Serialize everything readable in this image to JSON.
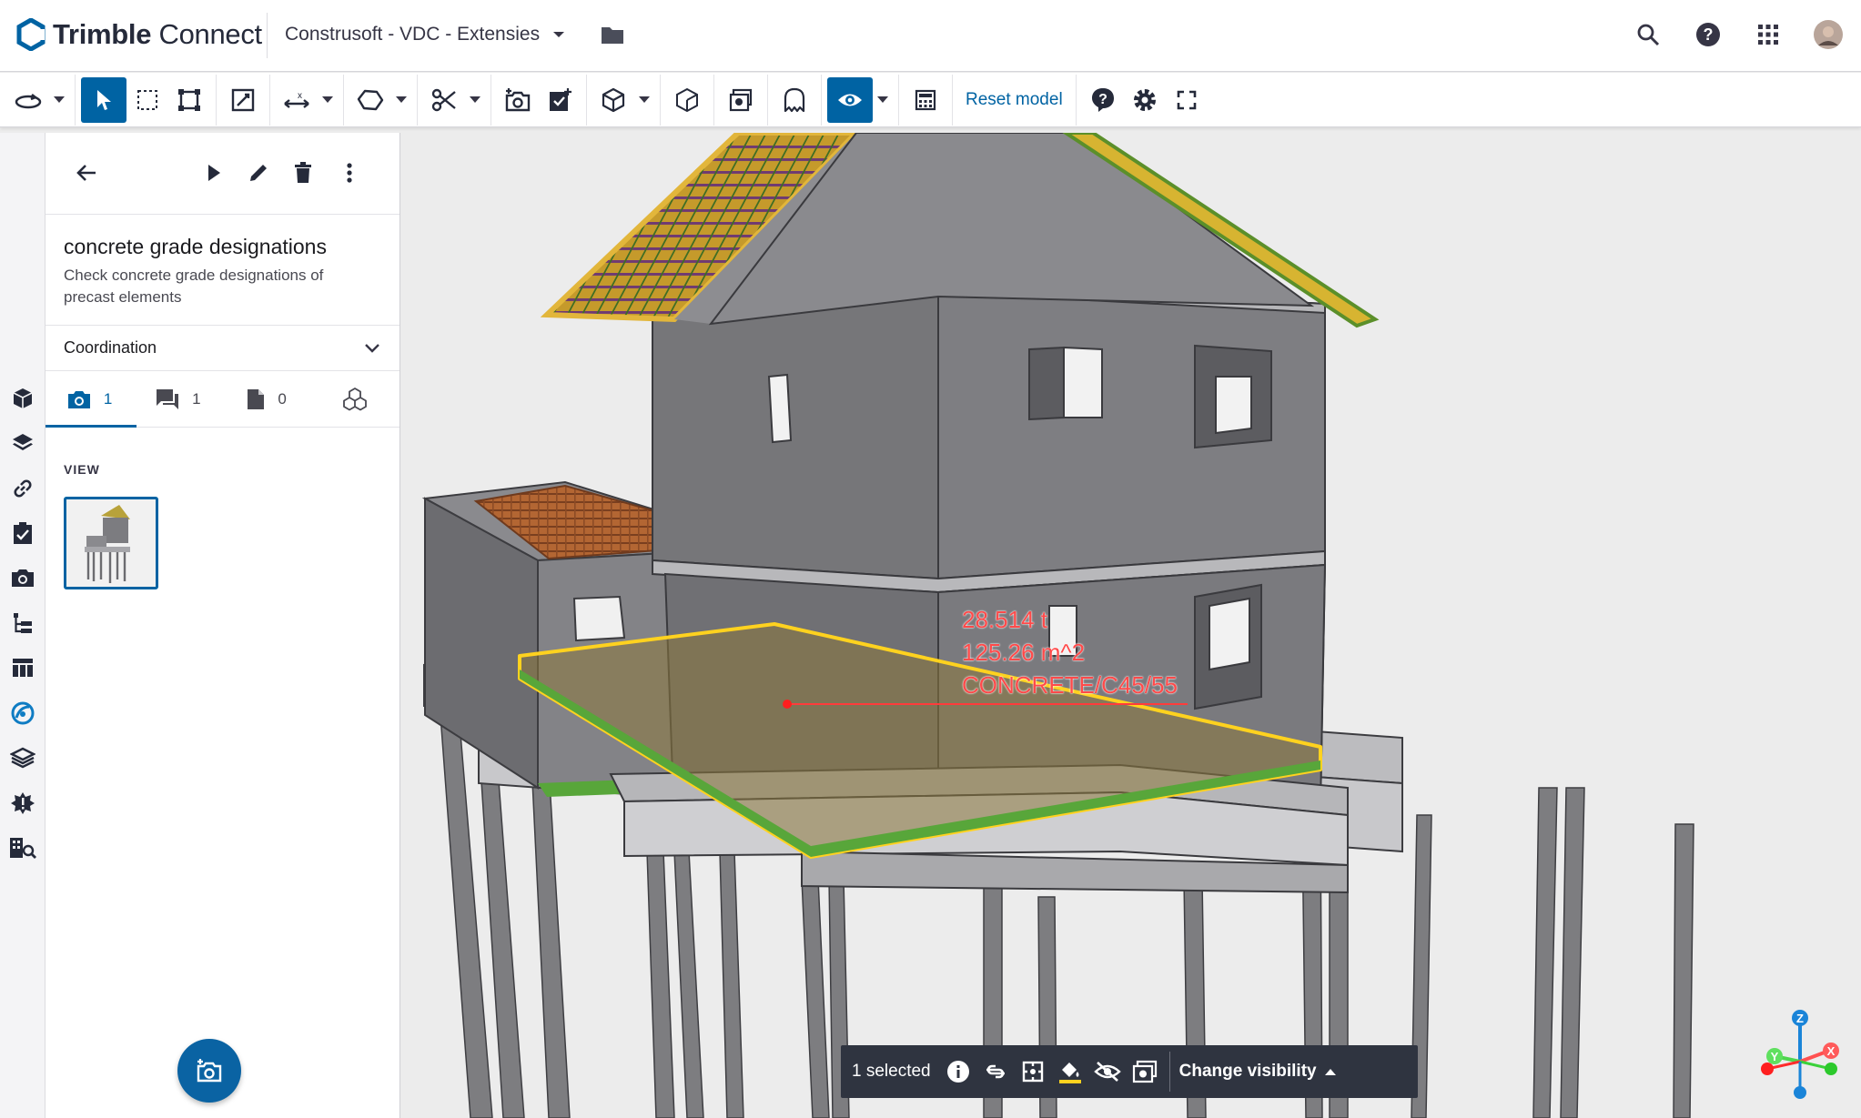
{
  "header": {
    "brand_bold": "Trimble",
    "brand_light": "Connect",
    "project_name": "Construsoft - VDC - Extensies",
    "icons": [
      "search-icon",
      "help-icon",
      "apps-grid-icon",
      "avatar"
    ]
  },
  "toolbar": {
    "reset_label": "Reset model",
    "tools": [
      "orbit-icon",
      "select-icon",
      "box-select-icon",
      "fit-icon",
      "markup-icon",
      "measure-icon",
      "freeform-icon",
      "section-cut-icon",
      "snapshot-icon",
      "add-todo-icon",
      "view-cube-icon",
      "wireframe-icon",
      "ghost-icon",
      "visibility-icon",
      "calculator-icon",
      "help-icon",
      "settings-icon",
      "fullscreen-icon"
    ]
  },
  "rail": {
    "items": [
      "models-icon",
      "layers-icon",
      "links-icon",
      "todos-icon",
      "views-icon",
      "tree-icon",
      "table-icon",
      "extension-icon",
      "stack-icon",
      "clash-icon",
      "building-search-icon"
    ]
  },
  "panel": {
    "topic_title": "concrete grade designations",
    "topic_desc": "Check concrete grade designations of precast elements",
    "coordination_label": "Coordination",
    "tabs": [
      {
        "icon": "camera-icon",
        "count": "1"
      },
      {
        "icon": "comment-icon",
        "count": "1"
      },
      {
        "icon": "document-icon",
        "count": "0"
      },
      {
        "icon": "objects-icon",
        "count": ""
      }
    ],
    "view_label": "VIEW"
  },
  "viewport": {
    "labels": {
      "weight": "28.514 t",
      "area": "125.26 m^2",
      "material": "CONCRETE/C45/55"
    },
    "axes": {
      "z": "Z",
      "x": "X",
      "y": "Y"
    }
  },
  "selection_bar": {
    "count_label": "1 selected",
    "change_visibility_label": "Change visibility"
  },
  "colors": {
    "accent": "#0063a3",
    "selection": "#ffd21f",
    "label": "#ff4a4a"
  }
}
